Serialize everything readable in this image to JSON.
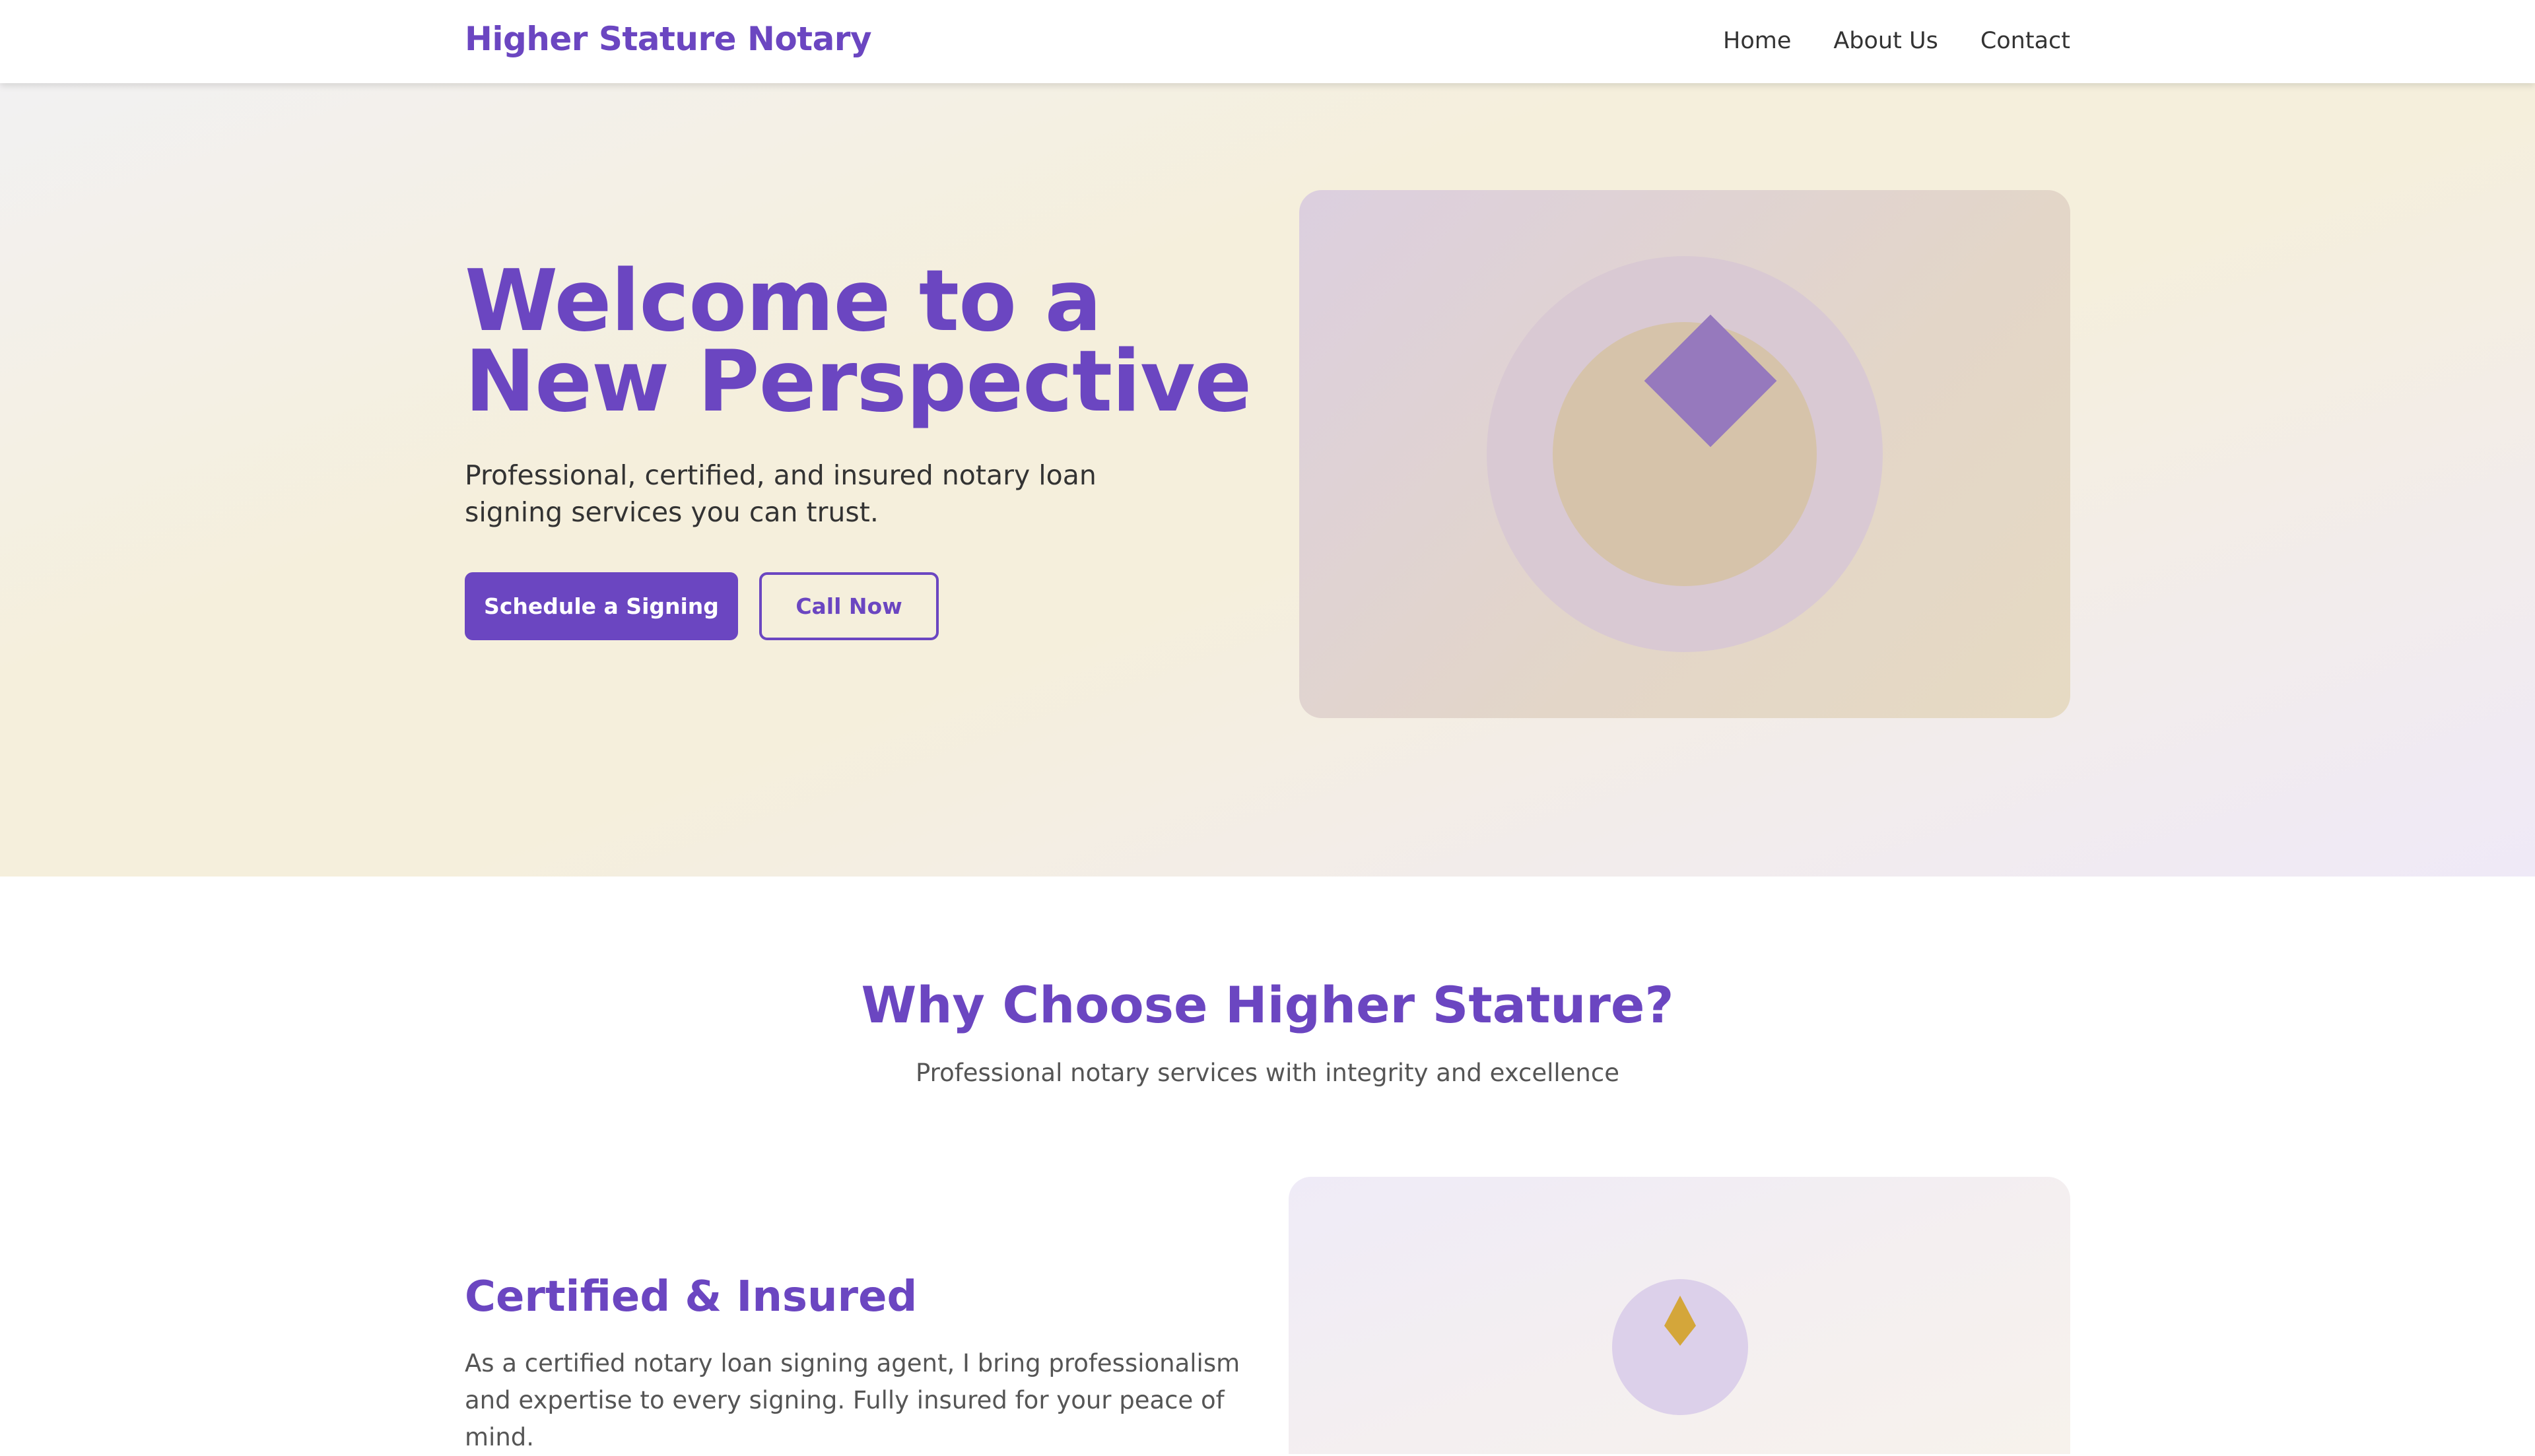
{
  "header": {
    "brand": "Higher Stature Notary",
    "nav": [
      {
        "label": "Home"
      },
      {
        "label": "About Us"
      },
      {
        "label": "Contact"
      }
    ]
  },
  "hero": {
    "title": "Welcome to a New Perspective",
    "subtitle": "Professional, certified, and insured notary loan signing services you can trust.",
    "primary_button": "Schedule a Signing",
    "secondary_button": "Call Now"
  },
  "why": {
    "title": "Why Choose Higher Stature?",
    "subtitle": "Professional notary services with integrity and excellence"
  },
  "feature": {
    "title": "Certified & Insured",
    "text": "As a certified notary loan signing agent, I bring professionalism and expertise to every signing. Fully insured for your peace of mind."
  },
  "colors": {
    "brand": "#6b46c1",
    "accent_gold": "#d4a63a"
  }
}
